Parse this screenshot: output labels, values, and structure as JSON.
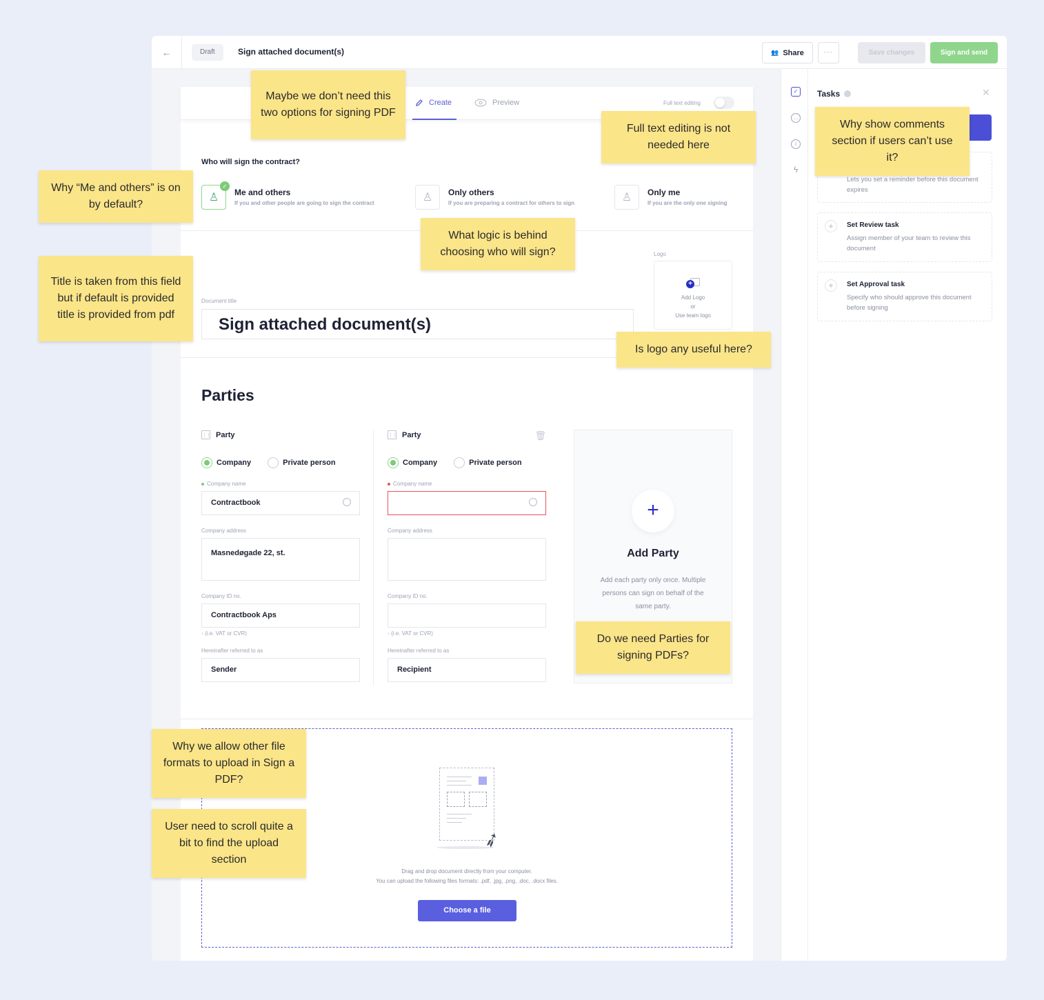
{
  "topbar": {
    "back_icon": "arrow-left-icon",
    "status": "Draft",
    "doc_name": "Sign attached document(s)",
    "share": "Share",
    "more": "···",
    "save": "Save changes",
    "sign_send": "Sign and send"
  },
  "editor_tabs": {
    "create": "Create",
    "preview": "Preview",
    "full_text_label": "Full text editing",
    "full_text_enabled": false
  },
  "signers": {
    "question": "Who will sign the contract?",
    "options": [
      {
        "title": "Me and others",
        "desc": "If you and other people are going to sign the contract",
        "selected": true
      },
      {
        "title": "Only others",
        "desc": "If you are preparing a contract for others to sign",
        "selected": false
      },
      {
        "title": "Only me",
        "desc": "If you are the only one signing",
        "selected": false
      }
    ]
  },
  "document": {
    "title_label": "Document title",
    "title_value": "Sign attached document(s)",
    "logo_label": "Logo",
    "logo_add": "Add Logo",
    "logo_or": "or",
    "logo_team": "Use team logo"
  },
  "parties": {
    "heading": "Parties",
    "items": [
      {
        "header": "Party",
        "company_label": "Company",
        "private_label": "Private person",
        "type": "Company",
        "name_label": "Company name",
        "name_value": "Contractbook",
        "address_label": "Company address",
        "address_value": "Masnedøgade 22, st.",
        "id_label": "Company ID no.",
        "id_value": "Contractbook Aps",
        "id_hint": "(i.e. VAT or CVR)",
        "ref_label": "Hereinafter referred to as",
        "ref_value": "Sender",
        "required_color": "#7ccb77"
      },
      {
        "header": "Party",
        "company_label": "Company",
        "private_label": "Private person",
        "type": "Company",
        "name_label": "Company name",
        "name_value": "",
        "address_label": "Company address",
        "address_value": "",
        "id_label": "Company ID no.",
        "id_value": "",
        "id_hint": "(i.e. VAT or CVR)",
        "ref_label": "Hereinafter referred to as",
        "ref_value": "Recipient",
        "required_color": "#e8525c"
      }
    ],
    "add_title": "Add Party",
    "add_text": "Add each party only once. Multiple persons can sign on behalf of the same party."
  },
  "upload": {
    "line1": "Drag and drop document directly from your computer.",
    "line2": "You can upload the following files formats: .pdf, .jpg, .png, .doc, .docx files.",
    "button": "Choose a file"
  },
  "tasks": {
    "title": "Tasks",
    "items": [
      {
        "title": "",
        "desc": "Lets you set a reminder before this document expires"
      },
      {
        "title": "Set Review task",
        "desc": "Assign member of your team to review this document"
      },
      {
        "title": "Set Approval task",
        "desc": "Specify who should approve this document before signing"
      }
    ]
  },
  "notes": {
    "n1": "Maybe we don’t need this two options for signing PDF",
    "n2": "Full text editing is not needed here",
    "n3": "Why show comments section if users can’t use it?",
    "n4": "Why “Me and others” is on by default?",
    "n5": "What logic is behind choosing who will sign?",
    "n6": "Title is taken from this field but if default is provided title is provided from pdf",
    "n7": "Is logo any useful here?",
    "n8": "Do we need Parties for signing PDFs?",
    "n9": "Why we allow other file formats to upload in Sign a PDF?",
    "n10": "User need to scroll quite a bit to find the upload section"
  },
  "colors": {
    "accent": "#5a5fd6",
    "success": "#8fd68c",
    "note": "#fbe589",
    "error": "#e8525c"
  }
}
